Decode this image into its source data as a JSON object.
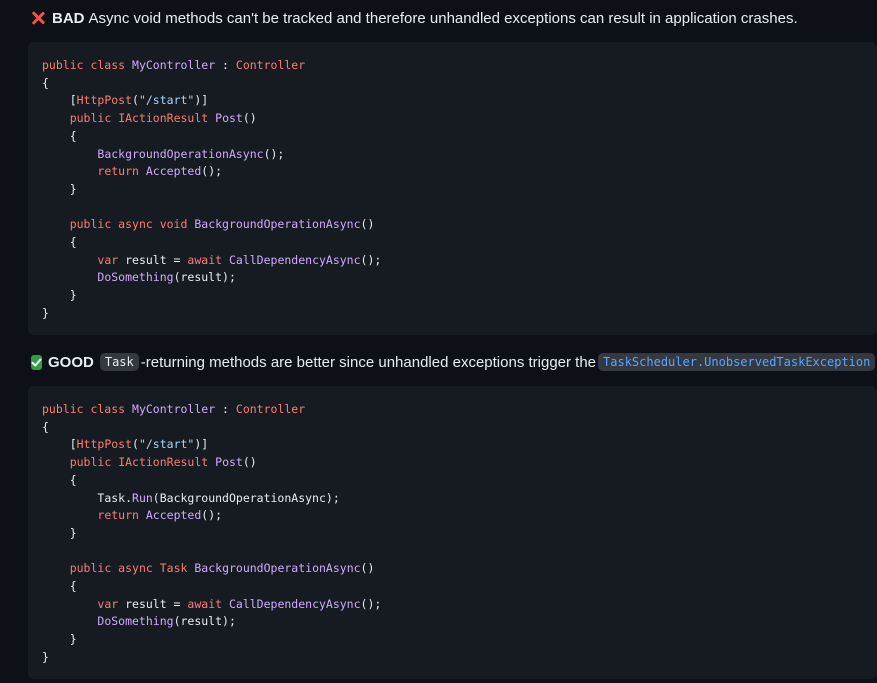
{
  "bad": {
    "label": "BAD",
    "text": "Async void methods can't be tracked and therefore unhandled exceptions can result in application crashes."
  },
  "good": {
    "label": "GOOD",
    "code_word": "Task",
    "text": "-returning methods are better since unhandled exceptions trigger the",
    "link": "TaskScheduler.UnobservedTaskException",
    "end": "."
  },
  "bad_code": {
    "class_kw": "public class",
    "class_name": "MyController",
    "base": "Controller",
    "open": "{",
    "close": "}",
    "attr": "HttpPost",
    "route": "\"/start\"",
    "post_kw": "public",
    "result_type": "IActionResult",
    "post_name": "Post",
    "call_bg": "BackgroundOperationAsync",
    "return_kw": "return",
    "accepted": "Accepted",
    "async_kw": "public async void",
    "bg_name": "BackgroundOperationAsync",
    "var_kw": "var",
    "await_kw": "await",
    "dep_call": "CallDependencyAsync",
    "do_call": "DoSomething"
  },
  "good_code": {
    "class_kw": "public class",
    "class_name": "MyController",
    "base": "Controller",
    "open": "{",
    "close": "}",
    "attr": "HttpPost",
    "route": "\"/start\"",
    "post_kw": "public",
    "result_type": "IActionResult",
    "post_name": "Post",
    "task_run": "Task.",
    "run_name": "Run",
    "run_arg": "BackgroundOperationAsync",
    "return_kw": "return",
    "accepted": "Accepted",
    "async_kw": "public async",
    "task_type": "Task",
    "bg_name": "BackgroundOperationAsync",
    "var_kw": "var",
    "await_kw": "await",
    "dep_call": "CallDependencyAsync",
    "do_call": "DoSomething"
  }
}
